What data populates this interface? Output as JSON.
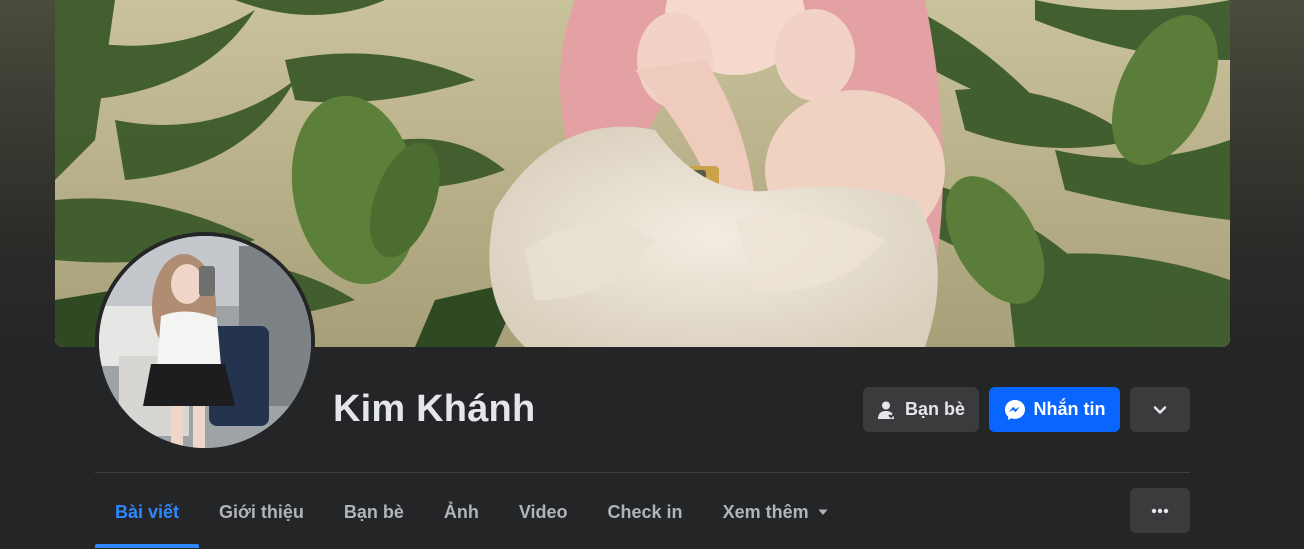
{
  "profile": {
    "name": "Kim Khánh"
  },
  "actions": {
    "friends_label": "Bạn bè",
    "message_label": "Nhắn tin"
  },
  "tabs": [
    {
      "label": "Bài viết",
      "active": true
    },
    {
      "label": "Giới thiệu",
      "active": false
    },
    {
      "label": "Bạn bè",
      "active": false
    },
    {
      "label": "Ảnh",
      "active": false
    },
    {
      "label": "Video",
      "active": false
    },
    {
      "label": "Check in",
      "active": false
    },
    {
      "label": "Xem thêm",
      "active": false
    }
  ],
  "icons": {
    "friends": "person-check-icon",
    "message": "messenger-icon",
    "dropdown": "chevron-down-icon",
    "tab_more_caret": "caret-down-icon",
    "tab_options": "ellipsis-icon"
  },
  "colors": {
    "background": "#242526",
    "primary": "#0866ff",
    "active_tab": "#2d88ff",
    "secondary_button": "#3a3b3c",
    "text": "#e4e6eb",
    "muted_text": "#b0b3b8"
  }
}
